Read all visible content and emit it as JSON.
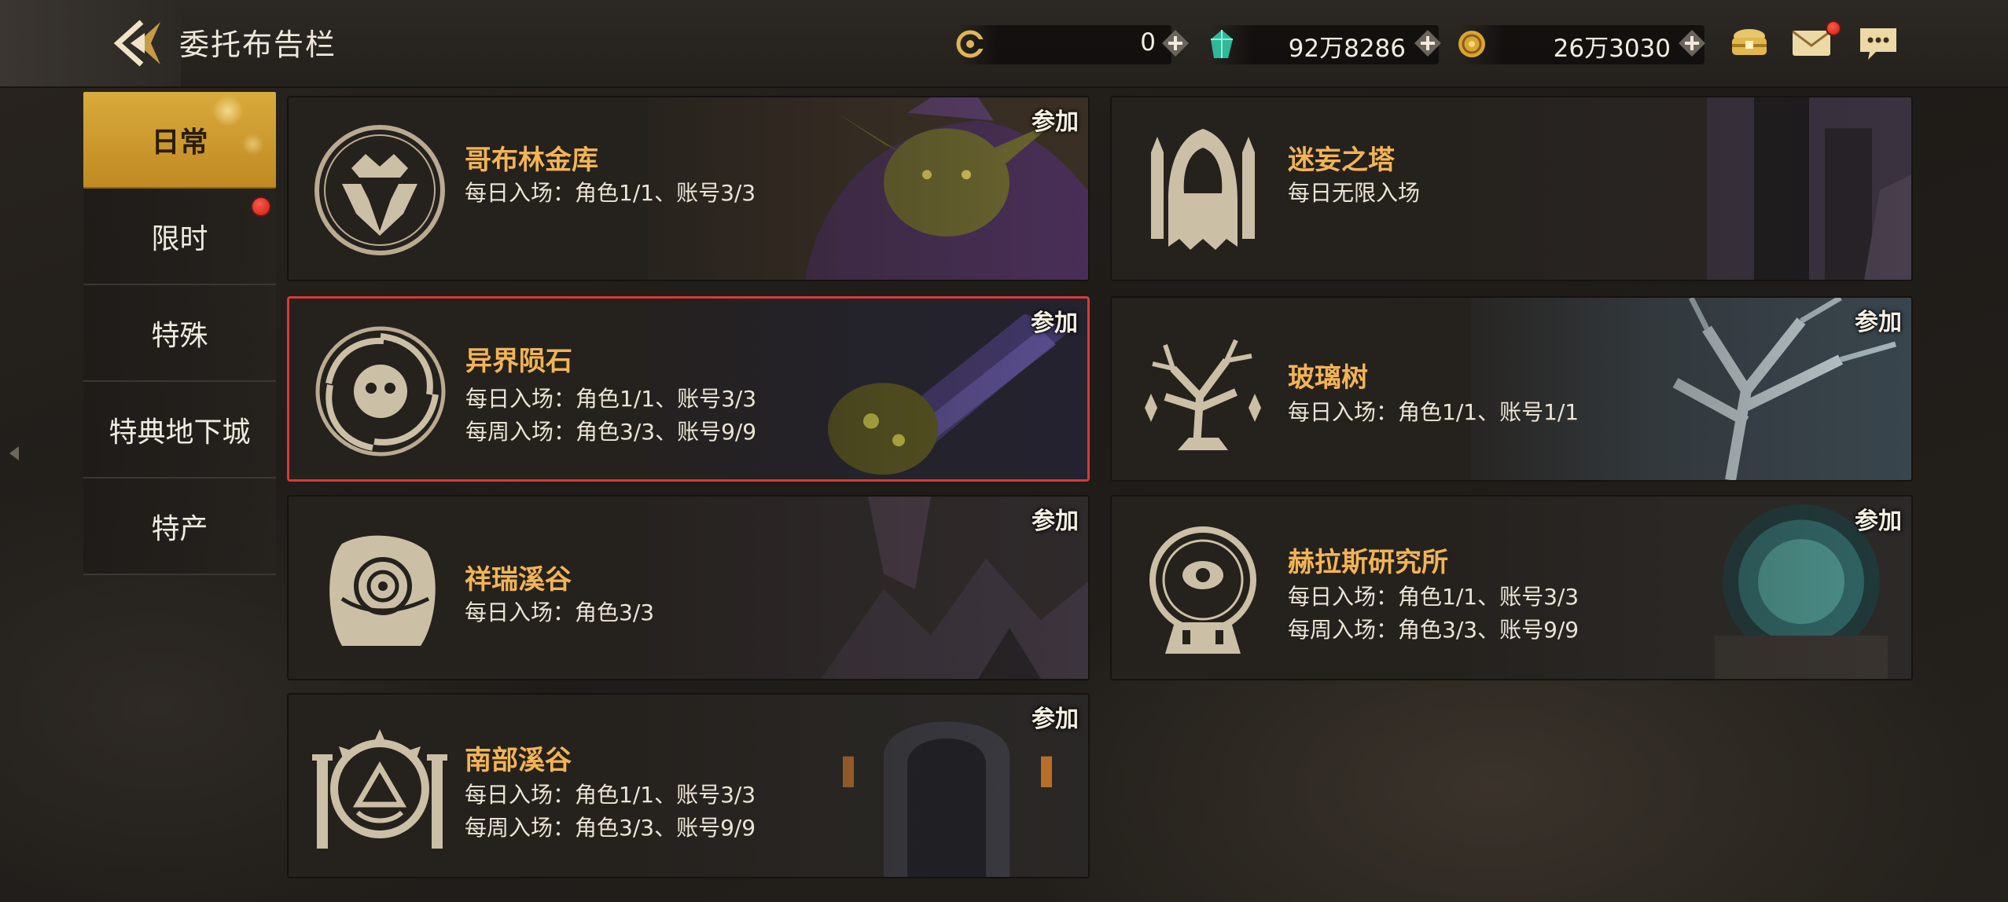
{
  "header": {
    "title": "委托布告栏",
    "currencies": [
      {
        "icon": "coupon-c-icon",
        "value": "0"
      },
      {
        "icon": "green-crystal-icon",
        "value": "92万8286"
      },
      {
        "icon": "gold-coin-icon",
        "value": "26万3030"
      }
    ],
    "icons": [
      "treasure-chest-icon",
      "mail-icon",
      "chat-icon"
    ]
  },
  "tabs": [
    {
      "label": "日常",
      "active": true,
      "badge": false
    },
    {
      "label": "限时",
      "active": false,
      "badge": true
    },
    {
      "label": "特殊",
      "active": false,
      "badge": false
    },
    {
      "label": "特典地下城",
      "active": false,
      "badge": false
    },
    {
      "label": "特产",
      "active": false,
      "badge": false
    }
  ],
  "cards": [
    {
      "title": "哥布林金库",
      "lines": [
        "每日入场：角色1/1、账号3/3"
      ],
      "join": "参加",
      "emblem": "goblin-crest-icon"
    },
    {
      "title": "迷妄之塔",
      "lines": [
        "每日无限入场"
      ],
      "join": "",
      "emblem": "hooded-tower-icon"
    },
    {
      "title": "异界陨石",
      "lines": [
        "每日入场：角色1/1、账号3/3",
        "每周入场：角色3/3、账号9/9"
      ],
      "join": "参加",
      "emblem": "vortex-meteor-icon",
      "selected": true
    },
    {
      "title": "玻璃树",
      "lines": [
        "每日入场：角色1/1、账号1/1"
      ],
      "join": "参加",
      "emblem": "glass-tree-icon"
    },
    {
      "title": "祥瑞溪谷",
      "lines": [
        "每日入场：角色3/3"
      ],
      "join": "参加",
      "emblem": "spiral-stone-icon"
    },
    {
      "title": "赫拉斯研究所",
      "lines": [
        "每日入场：角色1/1、账号3/3",
        "每周入场：角色3/3、账号9/9"
      ],
      "join": "参加",
      "emblem": "eye-portal-icon"
    },
    {
      "title": "南部溪谷",
      "lines": [
        "每日入场：角色1/1、账号3/3",
        "每周入场：角色3/3、账号9/9"
      ],
      "join": "参加",
      "emblem": "sun-pillars-icon"
    }
  ],
  "colors": {
    "accent_gold": "#d9aa3c",
    "card_title": "#f2b455",
    "selection_border": "#d83a36",
    "badge_red": "#d32015"
  }
}
